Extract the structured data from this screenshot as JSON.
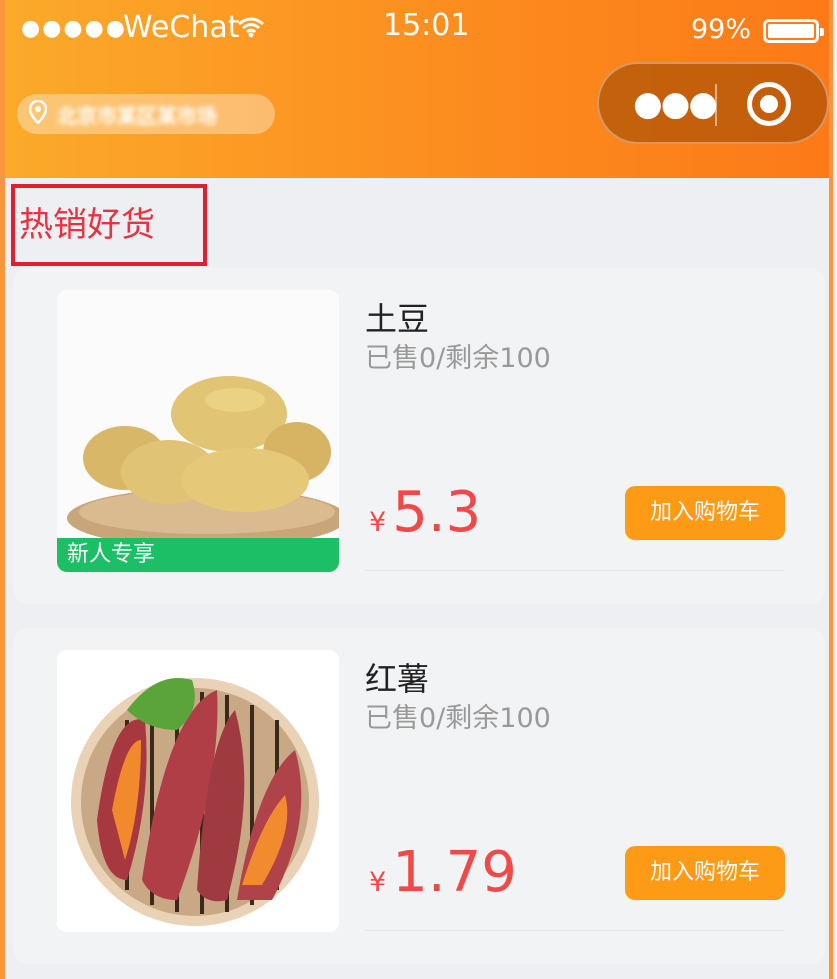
{
  "status_bar": {
    "signal": "●●●●●",
    "carrier": "WeChat",
    "time": "15:01",
    "battery": "99%"
  },
  "header": {
    "location": "北京市某区某市场",
    "more_icon": "●●●",
    "colors": {
      "gradient_start": "#fbaa2a",
      "gradient_end": "#fc7a18"
    }
  },
  "section": {
    "title": "热销好货"
  },
  "products": [
    {
      "name": "土豆",
      "sold": "已售0/剩余100",
      "currency": "¥",
      "price": "5.3",
      "badge": "新人专享",
      "cart_label": "加入购物车"
    },
    {
      "name": "红薯",
      "sold": "已售0/剩余100",
      "currency": "¥",
      "price": "1.79",
      "cart_label": "加入购物车"
    }
  ],
  "icons": [
    "signal-icon",
    "wifi-icon",
    "battery-icon",
    "location-pin-icon",
    "more-icon",
    "target-icon"
  ]
}
